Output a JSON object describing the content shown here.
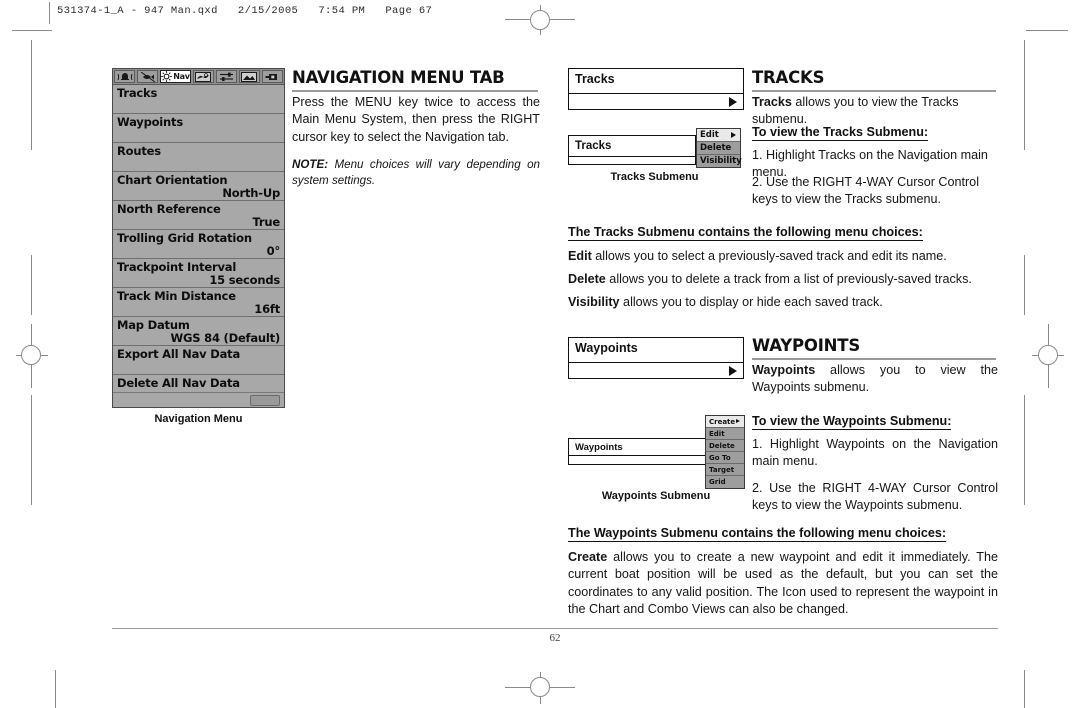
{
  "slug": "531374-1_A - 947 Man.qxd   2/15/2005   7:54 PM   Page 67",
  "page_number": "62",
  "left_column": {
    "heading": "NAVIGATION MENU TAB",
    "body": "Press the MENU key twice to access the Main Menu System, then press the RIGHT cursor key to select the Navigation tab.",
    "note_label": "NOTE:",
    "note_text": " Menu choices will vary depending on system settings.",
    "figure_caption": "Navigation Menu"
  },
  "device_menu": {
    "tabs": [
      {
        "name": "alarms-tab",
        "icon": "alarm-bell-icon",
        "label": "",
        "selected": false
      },
      {
        "name": "sonar-tab",
        "icon": "sonar-fish-icon",
        "label": "",
        "selected": false
      },
      {
        "name": "navigation-tab",
        "icon": "nav-compass-icon",
        "label": "Nav",
        "selected": true
      },
      {
        "name": "chart-tab",
        "icon": "chart-map-icon",
        "label": "",
        "selected": false
      },
      {
        "name": "setup-tab",
        "icon": "setup-sliders-icon",
        "label": "",
        "selected": false
      },
      {
        "name": "views-tab",
        "icon": "views-landscape-icon",
        "label": "",
        "selected": false
      },
      {
        "name": "accessories-tab",
        "icon": "accessories-plug-icon",
        "label": "",
        "selected": false
      }
    ],
    "items": [
      {
        "label": "Tracks",
        "value": ""
      },
      {
        "label": "Waypoints",
        "value": ""
      },
      {
        "label": "Routes",
        "value": ""
      },
      {
        "label": "Chart Orientation",
        "value": "North-Up"
      },
      {
        "label": "North Reference",
        "value": "True"
      },
      {
        "label": "Trolling Grid Rotation",
        "value": "0°"
      },
      {
        "label": "Trackpoint Interval",
        "value": "15 seconds"
      },
      {
        "label": "Track Min Distance",
        "value": "16ft"
      },
      {
        "label": "Map Datum",
        "value": "WGS 84 (Default)"
      },
      {
        "label": "Export All Nav Data",
        "value": ""
      },
      {
        "label": "Delete All Nav Data",
        "value": ""
      }
    ]
  },
  "tracks_section": {
    "heading": "TRACKS",
    "menu_box_label": "Tracks",
    "intro_bold": "Tracks",
    "intro_rest": " allows you to view the Tracks submenu.",
    "howto_heading": "To view the Tracks Submenu:",
    "step1": "1. Highlight Tracks on the Navigation main menu.",
    "step2": "2. Use the RIGHT 4-WAY Cursor Control keys to view the Tracks submenu.",
    "submenu_box_label": "Tracks",
    "submenu_items": [
      "Edit",
      "Delete",
      "Visibility"
    ],
    "figure_caption": "Tracks Submenu",
    "choices_heading": "The Tracks Submenu contains the following menu choices:",
    "choices": [
      {
        "term": "Edit",
        "desc": " allows you to select a previously-saved track and edit its name."
      },
      {
        "term": "Delete",
        "desc": " allows you to delete a track from a list of previously-saved tracks."
      },
      {
        "term": "Visibility",
        "desc": " allows you to display or hide each saved track."
      }
    ]
  },
  "waypoints_section": {
    "heading": "WAYPOINTS",
    "menu_box_label": "Waypoints",
    "intro_bold": "Waypoints",
    "intro_rest": " allows you to view the Waypoints submenu.",
    "howto_heading": "To view the Waypoints Submenu:",
    "step1": "1. Highlight Waypoints on the Navigation main menu.",
    "step2": "2. Use the RIGHT 4-WAY Cursor Control keys to view the Waypoints submenu.",
    "submenu_box_label": "Waypoints",
    "submenu_items": [
      "Create",
      "Edit",
      "Delete",
      "Go To",
      "Target",
      "Grid"
    ],
    "figure_caption": "Waypoints Submenu",
    "choices_heading": "The Waypoints Submenu contains the following menu choices:",
    "create_term": "Create",
    "create_desc": " allows you to create a new waypoint and edit it immediately. The current boat position will be used as the default, but you can set the coordinates to any valid position. The Icon used to represent the waypoint in the Chart and Combo Views can also be changed."
  }
}
